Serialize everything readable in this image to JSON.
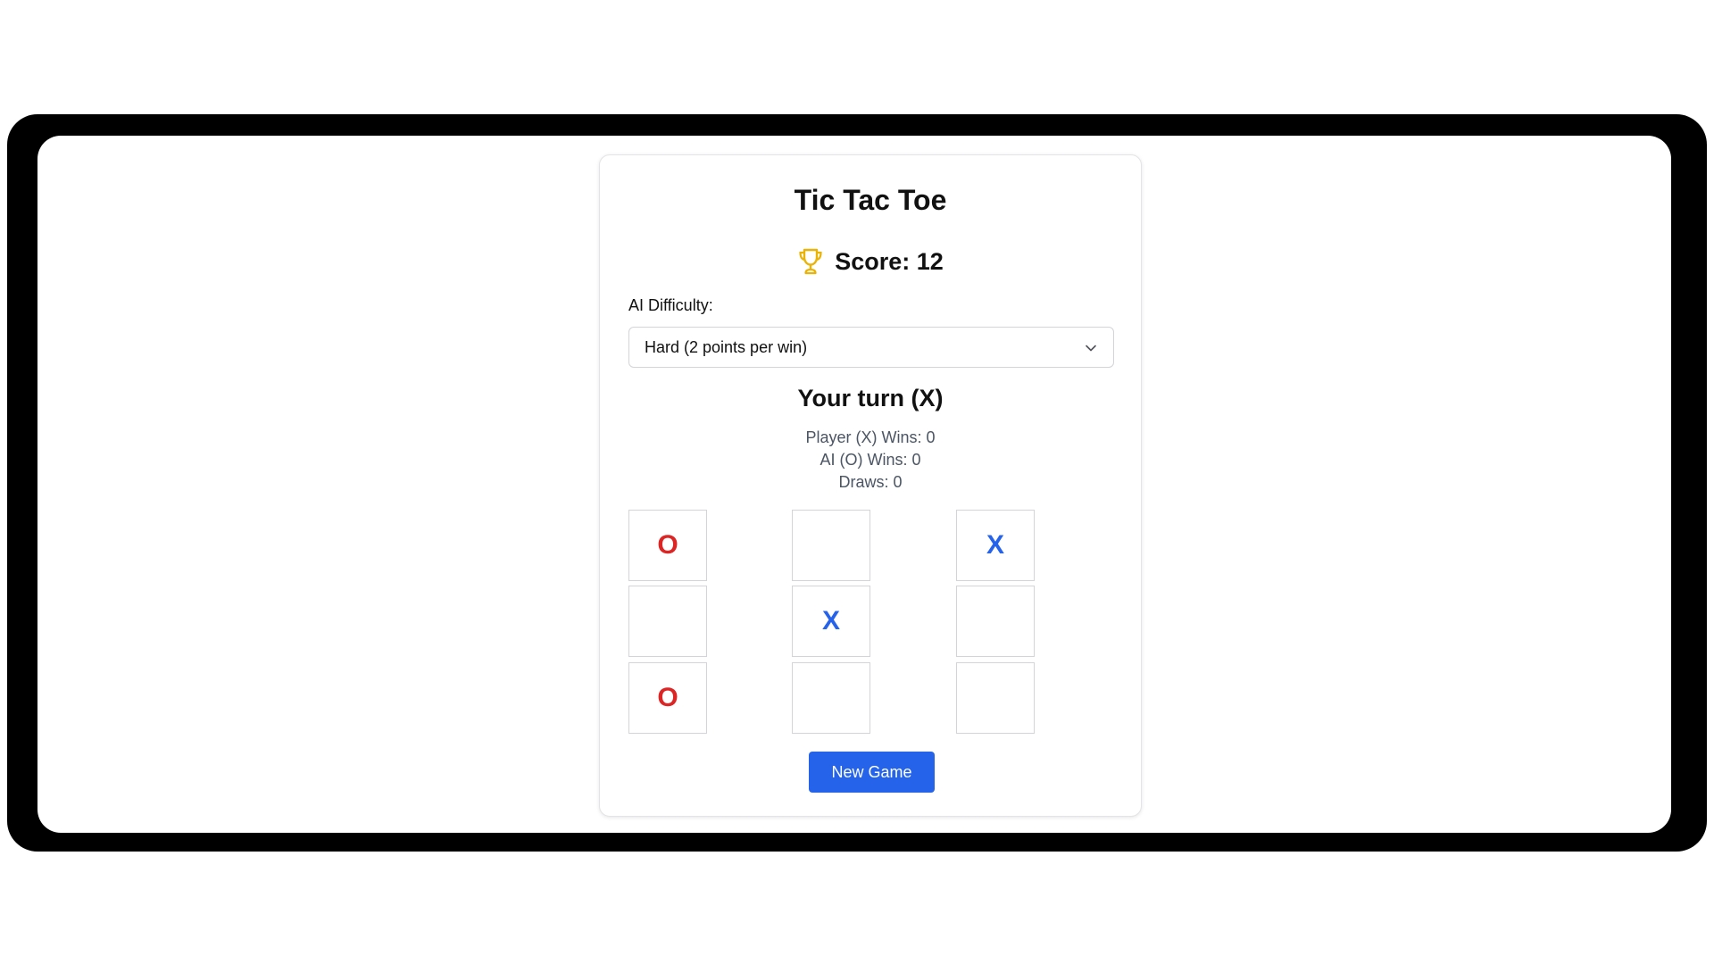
{
  "game": {
    "title": "Tic Tac Toe",
    "score_label": "Score: 12",
    "trophy_icon": "trophy-icon",
    "difficulty_label": "AI Difficulty:",
    "difficulty_selected": "Hard (2 points per win)",
    "status": "Your turn (X)",
    "stats": {
      "player_wins": "Player (X) Wins: 0",
      "ai_wins": "AI (O) Wins: 0",
      "draws": "Draws: 0"
    },
    "board": [
      "O",
      "",
      "X",
      "",
      "X",
      "",
      "O",
      "",
      ""
    ],
    "new_game_label": "New Game"
  },
  "colors": {
    "accent": "#2563eb",
    "x_mark": "#2563eb",
    "o_mark": "#dc2626",
    "trophy": "#eab308",
    "frame": "#000000"
  }
}
